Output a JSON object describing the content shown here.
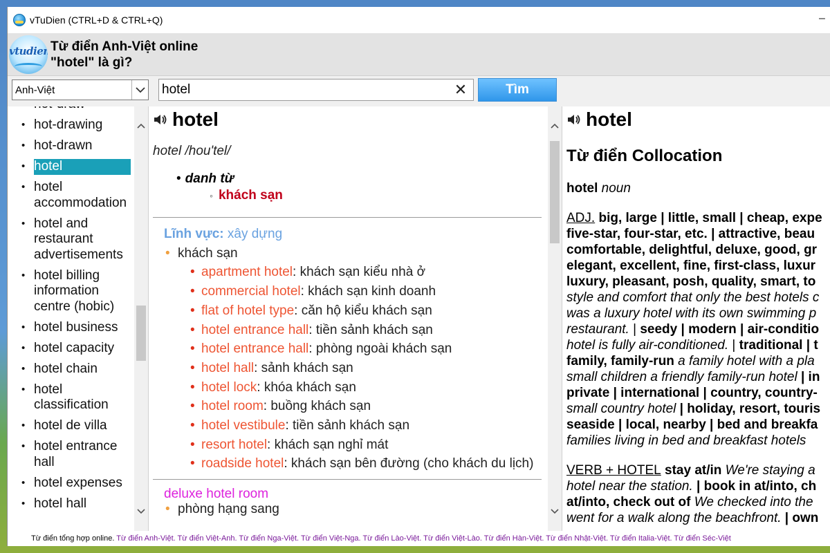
{
  "window": {
    "title": "vTuDien (CTRL+D & CTRL+Q)",
    "minimize_label": "–"
  },
  "header": {
    "logo_text": "vtudien",
    "line1": "Từ điển Anh-Việt online",
    "line2": "\"hotel\" là gì?"
  },
  "search": {
    "dictionary": "Anh-Việt",
    "query": "hotel",
    "clear_label": "✕",
    "button_label": "Tìm"
  },
  "word_list": {
    "items": [
      {
        "label": "hot-draw"
      },
      {
        "label": "hot-drawing"
      },
      {
        "label": "hot-drawn"
      },
      {
        "label": "hotel",
        "selected": true
      },
      {
        "label": "hotel accommodation"
      },
      {
        "label": "hotel and restaurant advertisements"
      },
      {
        "label": "hotel billing information centre (hobic)"
      },
      {
        "label": "hotel business"
      },
      {
        "label": "hotel capacity"
      },
      {
        "label": "hotel chain"
      },
      {
        "label": "hotel classification"
      },
      {
        "label": "hotel de villa"
      },
      {
        "label": "hotel entrance hall"
      },
      {
        "label": "hotel expenses"
      },
      {
        "label": "hotel hall"
      }
    ]
  },
  "entry": {
    "word": "hotel",
    "pronunciation": "hotel /hou'tel/",
    "pos": "danh từ",
    "main_meaning": "khách sạn",
    "field_label": "Lĩnh vực:",
    "field_value": "xây dựng",
    "sense": "khách sạn",
    "phrases": [
      {
        "term": "apartment hotel",
        "meaning": ": khách sạn kiểu nhà ở"
      },
      {
        "term": "commercial hotel",
        "meaning": ": khách sạn kinh doanh"
      },
      {
        "term": "flat of hotel type",
        "meaning": ": căn hộ kiểu khách sạn"
      },
      {
        "term": "hotel entrance hall",
        "meaning": ": tiền sảnh khách sạn"
      },
      {
        "term": "hotel entrance hall",
        "meaning": ": phòng ngoài khách sạn"
      },
      {
        "term": "hotel hall",
        "meaning": ": sảnh khách sạn"
      },
      {
        "term": "hotel lock",
        "meaning": ": khóa khách sạn"
      },
      {
        "term": "hotel room",
        "meaning": ": buồng khách sạn"
      },
      {
        "term": "hotel vestibule",
        "meaning": ": tiền sảnh khách sạn"
      },
      {
        "term": "resort hotel",
        "meaning": ": khách sạn nghỉ mát"
      },
      {
        "term": "roadside hotel",
        "meaning": ": khách sạn bên đường (cho khách du lịch)"
      }
    ],
    "deluxe_term": "deluxe hotel room",
    "deluxe_sense": "phòng hạng sang"
  },
  "collocation": {
    "word": "hotel",
    "title": "Từ điển Collocation",
    "head_word": "hotel",
    "head_pos": "noun",
    "adj_label": "ADJ.",
    "adj_lines": [
      [
        {
          "t": " big, large | little, small | cheap, expe",
          "s": "b"
        }
      ],
      [
        {
          "t": "five-star, four-star, etc. | attractive, beau",
          "s": "b"
        }
      ],
      [
        {
          "t": "comfortable, delightful, deluxe, good, gr",
          "s": "b"
        }
      ],
      [
        {
          "t": "elegant, excellent, fine, first-class, luxur",
          "s": "b"
        }
      ],
      [
        {
          "t": "luxury, pleasant, posh, quality, smart, to",
          "s": "b"
        }
      ],
      [
        {
          "t": "style and comfort that only the best hotels c",
          "s": "i"
        }
      ],
      [
        {
          "t": "was a luxury hotel with its own swimming p",
          "s": "i"
        }
      ],
      [
        {
          "t": "restaurant.",
          "s": "i"
        },
        {
          "t": " | ",
          "s": "n"
        },
        {
          "t": "seedy | modern | air-conditio",
          "s": "b"
        }
      ],
      [
        {
          "t": "hotel is fully air-conditioned.",
          "s": "i"
        },
        {
          "t": " | ",
          "s": "n"
        },
        {
          "t": "traditional | t",
          "s": "b"
        }
      ],
      [
        {
          "t": "family, family-run",
          "s": "b"
        },
        {
          "t": " a family hotel with a pla",
          "s": "i"
        }
      ],
      [
        {
          "t": "small children a friendly family-run hotel",
          "s": "i"
        },
        {
          "t": " | in",
          "s": "b"
        }
      ],
      [
        {
          "t": "private | international | country, country-",
          "s": "b"
        }
      ],
      [
        {
          "t": "small country hotel",
          "s": "i"
        },
        {
          "t": " | holiday, resort, touris",
          "s": "b"
        }
      ],
      [
        {
          "t": "seaside | local, nearby | bed and breakfa",
          "s": "b"
        }
      ],
      [
        {
          "t": "families living in bed and breakfast hotels",
          "s": "i"
        }
      ]
    ],
    "verb_label": "VERB + HOTEL",
    "verb_lines": [
      [
        {
          "t": " stay at/in",
          "s": "b"
        },
        {
          "t": " We're staying a",
          "s": "i"
        }
      ],
      [
        {
          "t": "hotel near the station.",
          "s": "i"
        },
        {
          "t": " | book in at/into, ch",
          "s": "b"
        }
      ],
      [
        {
          "t": "at/into, check out of",
          "s": "b"
        },
        {
          "t": " We checked into the",
          "s": "i"
        }
      ],
      [
        {
          "t": "went for a walk along the beachfront.",
          "s": "i"
        },
        {
          "t": " | own",
          "s": "b"
        }
      ]
    ]
  },
  "footer": {
    "lead": "Từ điển tổng hợp online.",
    "links": "Từ điển Anh-Việt. Từ điển Việt-Anh. Từ điển Nga-Việt. Từ điển Việt-Nga. Từ điển Lào-Việt. Từ điển Việt-Lào. Từ điển Hàn-Việt. Từ điển Nhật-Việt. Từ điển Italia-Việt. Từ điển Séc-Việt"
  }
}
